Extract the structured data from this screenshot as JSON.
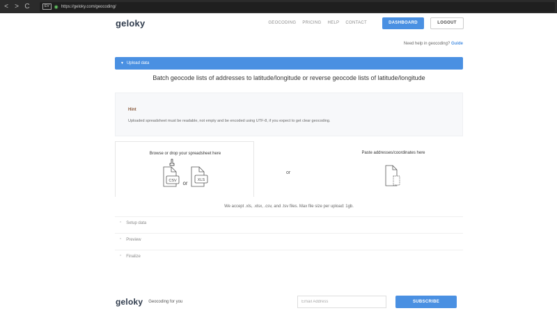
{
  "browser": {
    "back": "<",
    "forward": ">",
    "reload": "C",
    "badge": "EV",
    "url": "https://geloky.com/geocoding/"
  },
  "header": {
    "logo": "geloky",
    "nav": [
      "GEOCODING",
      "PRICING",
      "HELP",
      "CONTACT"
    ],
    "dashboard": "DASHBOARD",
    "logout": "LOGOUT"
  },
  "help": {
    "text": "Need help in geocoding? ",
    "link": "Guide"
  },
  "upload": {
    "label": "Upload data"
  },
  "batch_title": "Batch geocode lists of addresses to latitude/longitude or reverse geocode lists of latitude/longitude",
  "hint": {
    "title": "Hint",
    "text": "Uploaded spreadsheet must be readable, not empty and be encoded using UTF-8, if you expect to get clear geocoding."
  },
  "drop": {
    "browse_title": "Browse or drop your spreadsheet here",
    "csv": "CSV",
    "xls": "XLS",
    "or_small": "or",
    "or_mid": "or",
    "paste_title": "Paste addresses/coordinates here"
  },
  "accept": "We accept .xls, .xlsx, .csv, and .tsv files. Max file size per upload: 1gb.",
  "sections": [
    "Setup data",
    "Preview",
    "Finalize"
  ],
  "footer": {
    "logo": "geloky",
    "tagline": "Geocoding for you",
    "email_placeholder": "Email Address",
    "subscribe": "SUBSCRIBE"
  },
  "colors": {
    "accent": "#4a90e2",
    "logo": "#2f3b4c",
    "hint_title": "#8a5a3c"
  }
}
